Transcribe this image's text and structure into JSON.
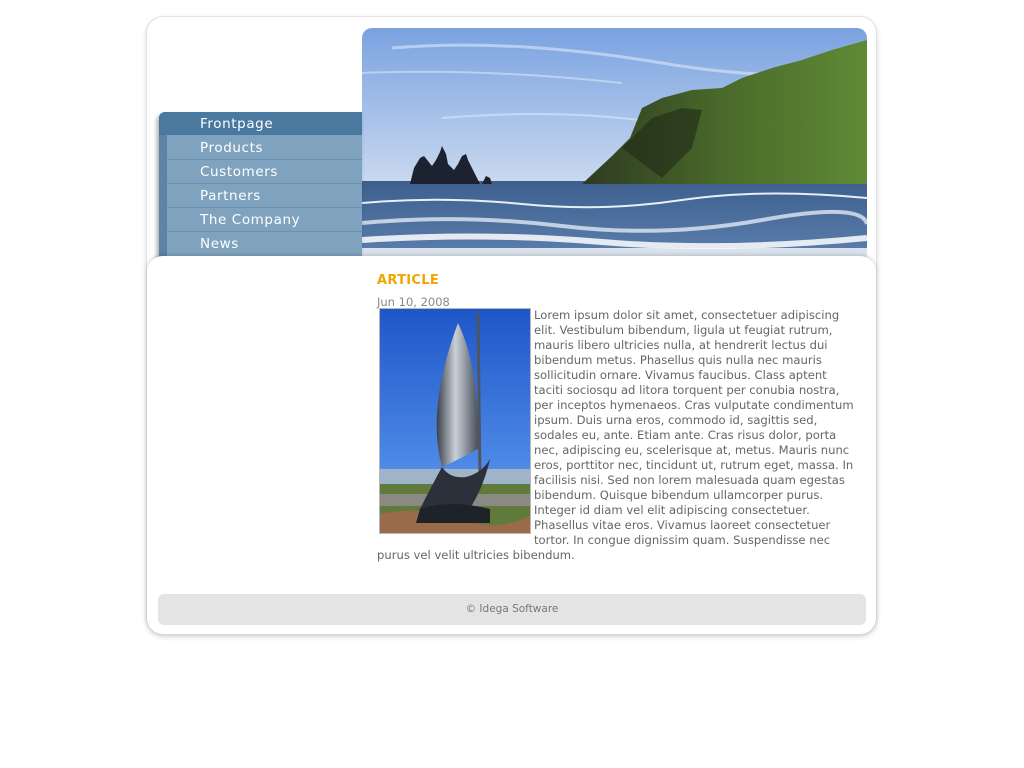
{
  "nav": {
    "items": [
      {
        "label": "Frontpage",
        "active": true
      },
      {
        "label": "Products"
      },
      {
        "label": "Customers"
      },
      {
        "label": "Partners"
      },
      {
        "label": "The Company"
      },
      {
        "label": "News"
      }
    ]
  },
  "header": {
    "image": "coastal-cliffs-sea-photo"
  },
  "article": {
    "title": "ARTICLE",
    "date": "Jun 10, 2008",
    "image": "sail-sculpture-photo",
    "body": "Lorem ipsum dolor sit amet, consectetuer adipiscing elit. Vestibulum bibendum, ligula ut feugiat rutrum, mauris libero ultricies nulla, at hendrerit lectus dui bibendum metus. Phasellus quis nulla nec mauris sollicitudin ornare. Vivamus faucibus. Class aptent taciti sociosqu ad litora torquent per conubia nostra, per inceptos hymenaeos. Cras vulputate condimentum ipsum. Duis urna eros, commodo id, sagittis sed, sodales eu, ante. Etiam ante. Cras risus dolor, porta nec, adipiscing eu, scelerisque at, metus. Mauris nunc eros, porttitor nec, tincidunt ut, rutrum eget, massa. In facilisis nisi. Sed non lorem malesuada quam egestas bibendum. Quisque bibendum ullamcorper purus. Integer id diam vel elit adipiscing consectetuer. Phasellus vitae eros. Vivamus laoreet consectetuer tortor. In congue dignissim quam. Suspendisse nec purus vel velit ultricies bibendum."
  },
  "footer": {
    "text": "© Idega Software"
  },
  "colors": {
    "accent": "#f0a500",
    "nav_bg": "#7fa3be",
    "nav_active": "#4a79a0"
  }
}
